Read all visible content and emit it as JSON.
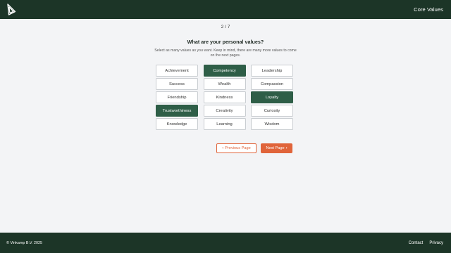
{
  "header": {
    "logo_icon": "vinkamp-logo-icon",
    "title": "Core Values"
  },
  "main": {
    "step": "2 / 7",
    "question": "What are your personal values?",
    "instructions": "Select as many values as you want. Keep in mind, there are many more values to come on the next pages."
  },
  "values": [
    {
      "label": "Achievement",
      "selected": false
    },
    {
      "label": "Competency",
      "selected": true
    },
    {
      "label": "Leadership",
      "selected": false
    },
    {
      "label": "Success",
      "selected": false
    },
    {
      "label": "Wealth",
      "selected": false
    },
    {
      "label": "Compassion",
      "selected": false
    },
    {
      "label": "Friendship",
      "selected": false
    },
    {
      "label": "Kindness",
      "selected": false
    },
    {
      "label": "Loyalty",
      "selected": true
    },
    {
      "label": "Trustworthiness",
      "selected": true
    },
    {
      "label": "Creativity",
      "selected": false
    },
    {
      "label": "Curiosity",
      "selected": false
    },
    {
      "label": "Knowledge",
      "selected": false
    },
    {
      "label": "Learning",
      "selected": false
    },
    {
      "label": "Wisdom",
      "selected": false
    }
  ],
  "nav": {
    "prev_label": "Previous Page",
    "next_label": "Next Page",
    "prev_icon": "chevron-left-icon",
    "next_icon": "chevron-right-icon"
  },
  "footer": {
    "copyright": "© Vinkamp B.V. 2025",
    "links": [
      "Contact",
      "Privacy"
    ]
  },
  "colors": {
    "header_bg": "#1c3527",
    "selected_bg": "#2e5e47",
    "accent": "#e0643a",
    "page_bg": "#f3f4f6"
  }
}
